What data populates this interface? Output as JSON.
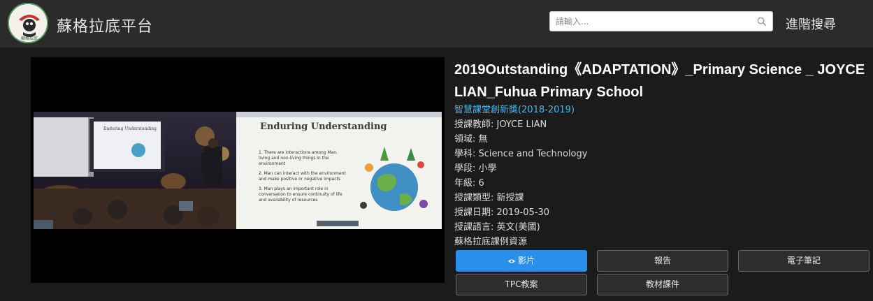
{
  "header": {
    "site_title": "蘇格拉底平台",
    "search_placeholder": "請輸入...",
    "advanced_search": "進階搜尋",
    "logo_text": "蘇格拉底"
  },
  "video": {
    "slide_title": "Enduring Understanding",
    "points": [
      "1. There are interactions among Man, living and non-living things in the environment",
      "2. Man can interact with the environment and make positive or negative impacts",
      "3. Man plays an important role in conversation to ensure continuity of life and availability of resources"
    ]
  },
  "lesson": {
    "title": "2019Outstanding《ADAPTATION》_Primary Science _ JOYCE LIAN_Fuhua Primary School",
    "series": "智慧課堂創新獎(2018-2019)",
    "teacher": "授課教師: JOYCE LIAN",
    "field": "領域: 無",
    "subject": "學科: Science and Technology",
    "stage": "學段: 小學",
    "grade": "年級: 6",
    "type": "授課類型: 新授課",
    "date": "授課日期: 2019-05-30",
    "language": "授課語言: 英文(美國)",
    "source": "蘇格拉底課例資源"
  },
  "buttons": {
    "video": "影片",
    "report": "報告",
    "notes": "電子筆記",
    "tpc": "TPC教案",
    "materials": "教材課件"
  },
  "colors": {
    "accent": "#2b8ee8",
    "link": "#4fb6e8",
    "background": "#1b1b1b",
    "header": "#2b2b2b"
  }
}
